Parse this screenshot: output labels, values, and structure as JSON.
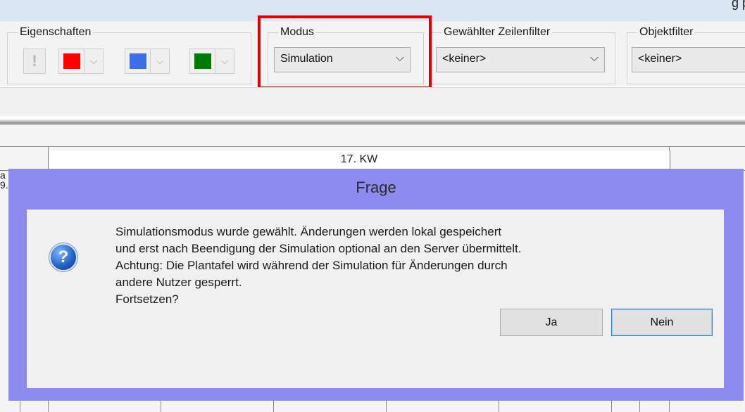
{
  "window": {
    "corner_text": "g p"
  },
  "ribbon": {
    "properties_group": {
      "label": "Eigenschaften",
      "exclamation": "!",
      "swatches": [
        {
          "color": "#ff0000",
          "arrow": "⌵"
        },
        {
          "color": "#3c6ee8",
          "arrow": "⌵"
        },
        {
          "color": "#007a00",
          "arrow": "⌵"
        }
      ]
    },
    "mode_group": {
      "label": "Modus",
      "value": "Simulation",
      "arrow": "⌵"
    },
    "row_filter_group": {
      "label": "Gewählter Zeilenfilter",
      "value": "<keiner>",
      "arrow": "⌵"
    },
    "object_filter_group": {
      "label": "Objektfilter",
      "value": "<keiner>"
    }
  },
  "grid": {
    "week_label": "17. KW",
    "edge_text_1": "a",
    "edge_text_2": "9."
  },
  "dialog": {
    "title": "Frage",
    "icon": "question-icon",
    "message_lines": [
      "Simulationsmodus wurde gewählt. Änderungen werden lokal gespeichert",
      "und erst nach Beendigung der Simulation optional an den Server übermittelt.",
      "Achtung: Die Plantafel wird während der Simulation für Änderungen durch",
      "andere Nutzer gesperrt.",
      "Fortsetzen?"
    ],
    "yes_label": "Ja",
    "no_label": "Nein"
  },
  "colors": {
    "dialog_frame": "#8b8bf0",
    "highlight": "#e00000"
  }
}
